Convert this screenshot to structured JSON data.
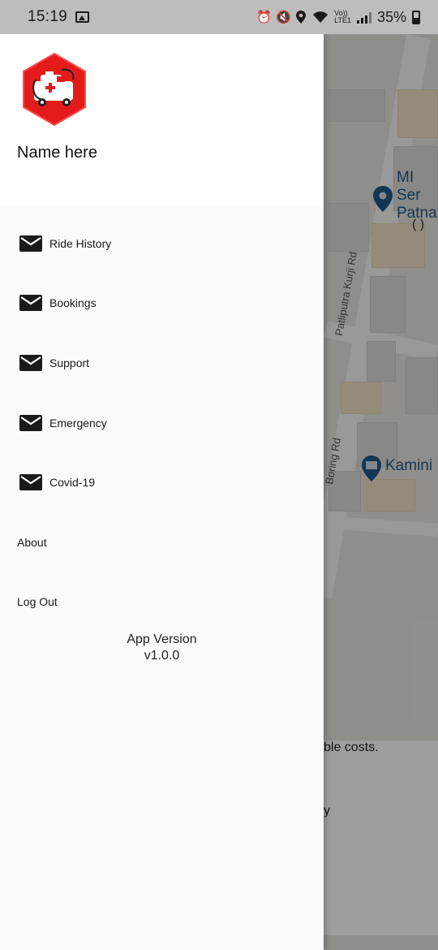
{
  "status_bar": {
    "time": "15:19",
    "battery_percent": "35%",
    "icons": [
      "gallery-icon",
      "alarm-icon",
      "mute-icon",
      "location-icon",
      "wifi-icon",
      "volte-icon",
      "signal-icon",
      "battery-icon"
    ],
    "volte_label": "Vo))",
    "lte_label": "LTE1"
  },
  "drawer": {
    "header": {
      "logo": "ambulance-logo",
      "user_name": "Name here"
    },
    "menu": [
      {
        "label": "Ride History",
        "icon": "mail-icon"
      },
      {
        "label": "Bookings",
        "icon": "mail-icon"
      },
      {
        "label": "Support",
        "icon": "mail-icon"
      },
      {
        "label": "Emergency",
        "icon": "mail-icon"
      },
      {
        "label": "Covid-19",
        "icon": "mail-icon"
      },
      {
        "label": "About",
        "icon": ""
      },
      {
        "label": "Log Out",
        "icon": ""
      }
    ],
    "version_title": "App Version",
    "version_number": "v1.0.0"
  },
  "background": {
    "poi_1_line1": "MI Ser",
    "poi_1_line2": "Patna",
    "poi_1_sub": "( )",
    "road_1": "Patliputra Kurji Rd",
    "road_2": "Boring Rd",
    "poi_2": "Kamini",
    "sheet_text_1": "ble costs.",
    "sheet_text_2": "y"
  },
  "colors": {
    "logo_red": "#e31b1b",
    "drawer_bg": "#fafafa",
    "header_bg": "#ffffff",
    "status_bar_bg": "#bdbdbd"
  }
}
